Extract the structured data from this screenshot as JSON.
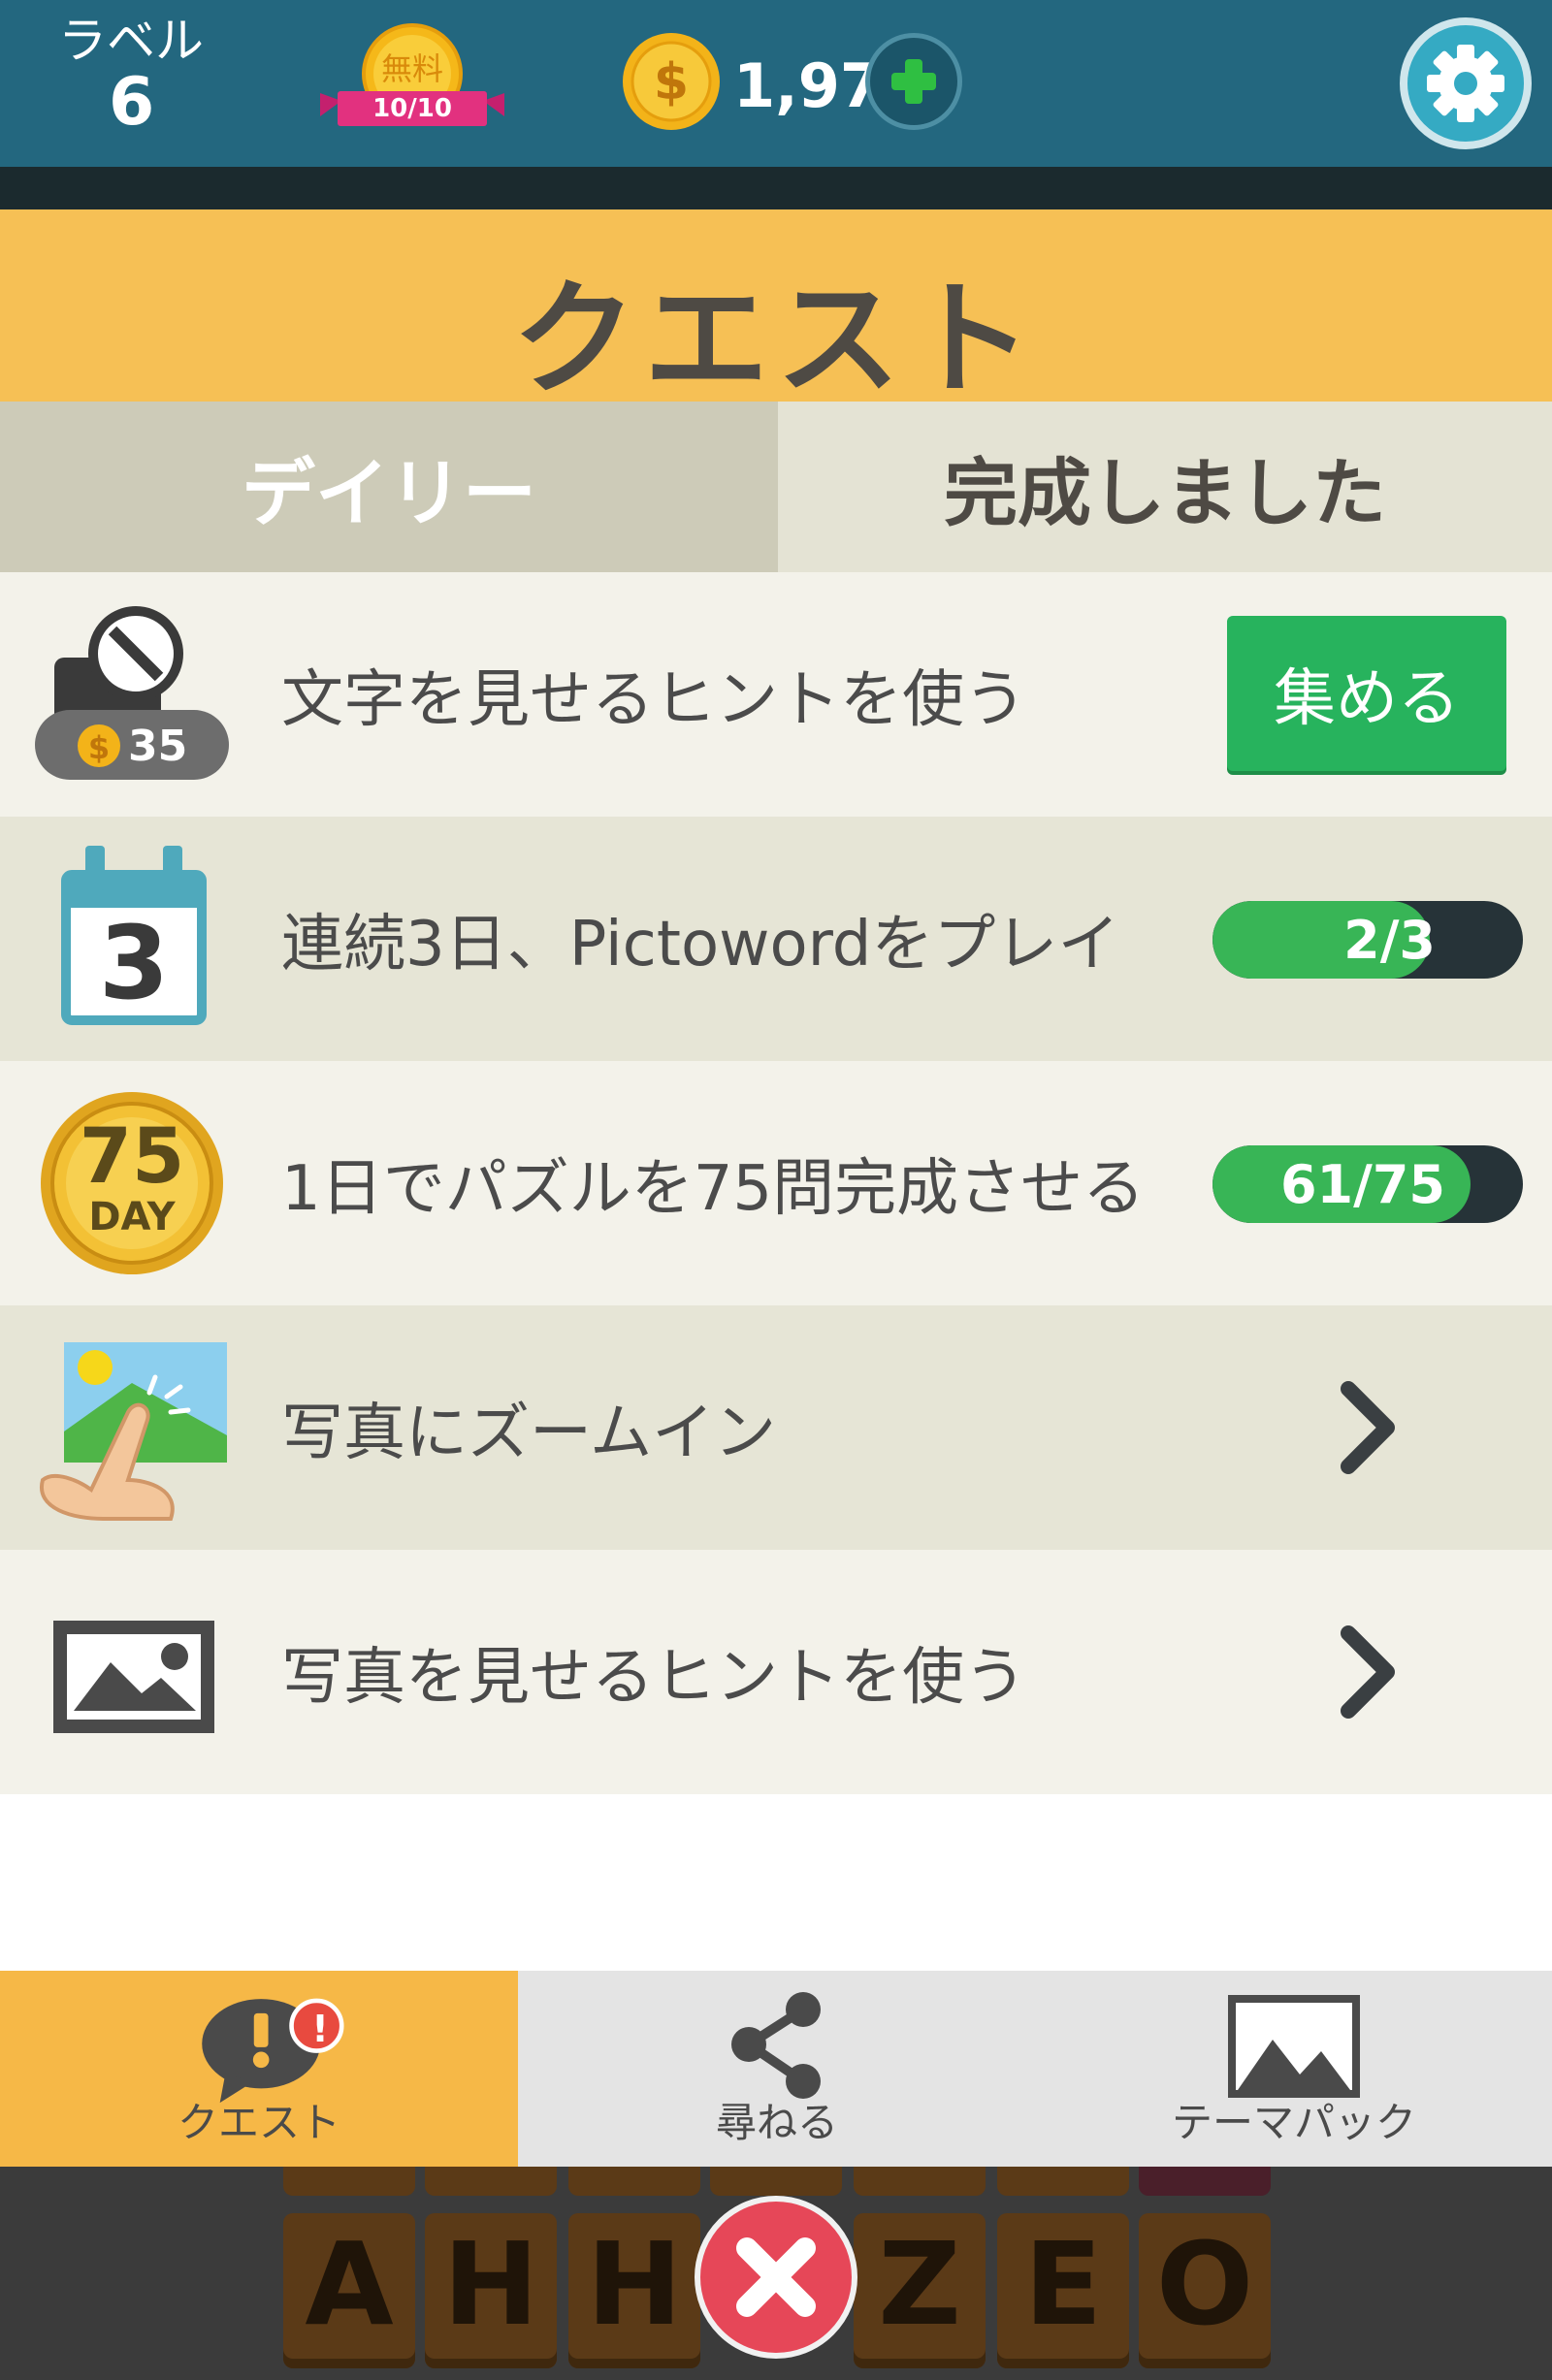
{
  "header": {
    "level_label": "ラベル",
    "level_value": "6",
    "free_badge": {
      "text": "無料",
      "count": "10/10"
    },
    "coins": "1,971",
    "add_coins_icon": "plus-icon",
    "settings_icon": "gear-icon"
  },
  "title": "クエスト",
  "tabs": [
    {
      "label": "デイリー",
      "active": true
    },
    {
      "label": "完成しました",
      "active": false
    }
  ],
  "quests": [
    {
      "text": "文字を見せるヒントを使う",
      "icon": "magnifier-hint-icon",
      "icon_cost": "35",
      "action": "collect",
      "action_label": "集める"
    },
    {
      "text": "連続3日、Pictowordをプレイ",
      "icon": "calendar-icon",
      "icon_text": "3",
      "action": "progress",
      "progress_label": "2/3",
      "progress": 0.667
    },
    {
      "text": "1日でパズルを75問完成させる",
      "icon": "day-medal-icon",
      "icon_text": "75",
      "icon_subtext": "DAY",
      "action": "progress",
      "progress_label": "61/75",
      "progress": 0.813
    },
    {
      "text": "写真にズームイン",
      "icon": "pinch-zoom-icon",
      "action": "navigate"
    },
    {
      "text": "写真を見せるヒントを使う",
      "icon": "photo-icon",
      "action": "navigate"
    }
  ],
  "bottom_nav": [
    {
      "label": "クエスト",
      "icon": "quest-speech-icon",
      "active": true,
      "badge": "!"
    },
    {
      "label": "尋ねる",
      "icon": "share-icon",
      "active": false
    },
    {
      "label": "テーマパック",
      "icon": "mountain-photo-icon",
      "active": false
    }
  ],
  "keyboard": {
    "letters": [
      "A",
      "H",
      "H",
      "",
      "Z",
      "E",
      "O"
    ],
    "delete_icon": "close-icon"
  },
  "colors": {
    "header": "#23677f",
    "title_bar": "#f6c055",
    "collect_button": "#27b35d",
    "progress_fill": "#38b556",
    "active_nav": "#f6b847"
  }
}
